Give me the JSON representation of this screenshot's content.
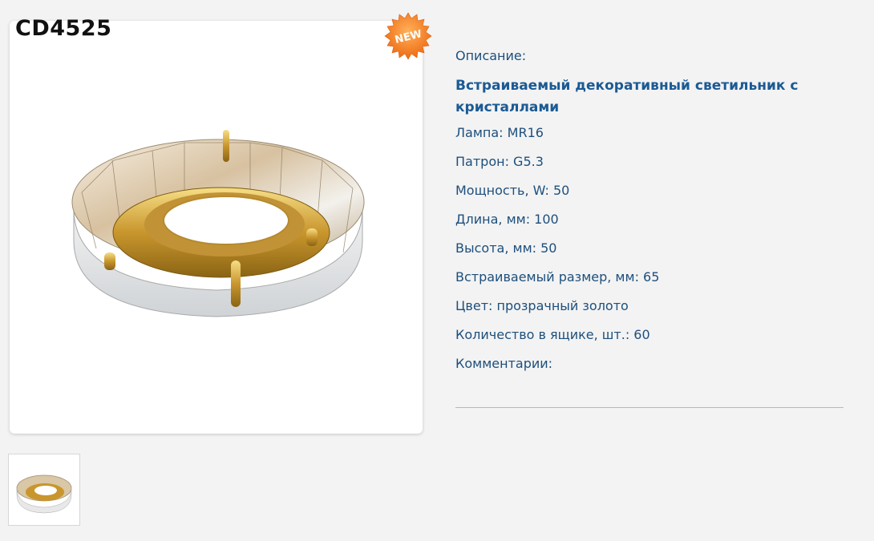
{
  "product": {
    "code": "CD4525",
    "badge": "NEW",
    "photo": "crystal-downlight-photo",
    "thumbnail": "crystal-downlight-thumbnail"
  },
  "details": {
    "description_label": "Описание:",
    "title": "Встраиваемый декоративный светильник с кристаллами",
    "lamp": "Лампа: MR16",
    "socket": "Патрон: G5.3",
    "power": "Мощность, W: 50",
    "length": "Длина, мм: 100",
    "height": "Высота, мм: 50",
    "cutout": "Встраиваемый размер, мм: 65",
    "color": "Цвет: прозрачный золото",
    "box_qty": "Количество в ящике, шт.: 60",
    "comments": "Комментарии:"
  },
  "colors": {
    "badge": "#f47b20",
    "text": "#1d4f7c",
    "title": "#1b5a94"
  }
}
